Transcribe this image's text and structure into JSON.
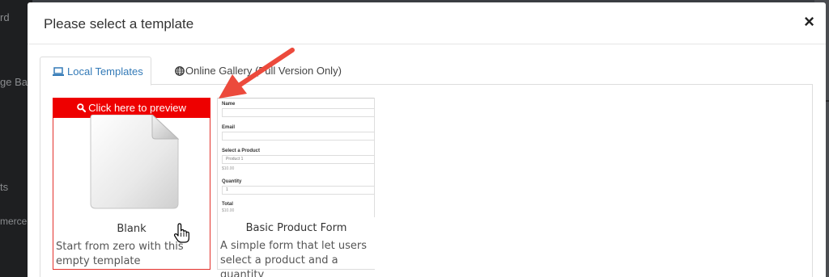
{
  "background": {
    "sidebar_fragments": [
      "rd",
      "ge Bas",
      "ts",
      "merce"
    ]
  },
  "modal": {
    "title": "Please select a template",
    "close_label": "×"
  },
  "tabs": [
    {
      "label": "Local Templates",
      "icon": "laptop-icon",
      "active": true
    },
    {
      "label": "Online Gallery (Full Version Only)",
      "icon": "globe-icon",
      "active": false
    }
  ],
  "templates": [
    {
      "title": "Blank",
      "description": "Start from zero with this empty template",
      "preview_label": "Click here to preview",
      "icon": "blank-document-icon",
      "selected": true
    },
    {
      "title": "Basic Product Form",
      "description": "A simple form that let users select a product and a quantity",
      "thumbnail": {
        "fields": [
          {
            "label": "Name",
            "value": ""
          },
          {
            "label": "Email",
            "value": ""
          },
          {
            "label": "Select a Product",
            "value": "Product 1",
            "price": "$10.00"
          },
          {
            "label": "Quantity",
            "value": "1"
          },
          {
            "label": "Total",
            "price": "$10.00"
          }
        ]
      }
    }
  ],
  "colors": {
    "accent": "#337ab7",
    "preview_bar": "#ee0000",
    "selected_border": "#e3312c",
    "annotation_arrow": "#ec4a3c"
  }
}
